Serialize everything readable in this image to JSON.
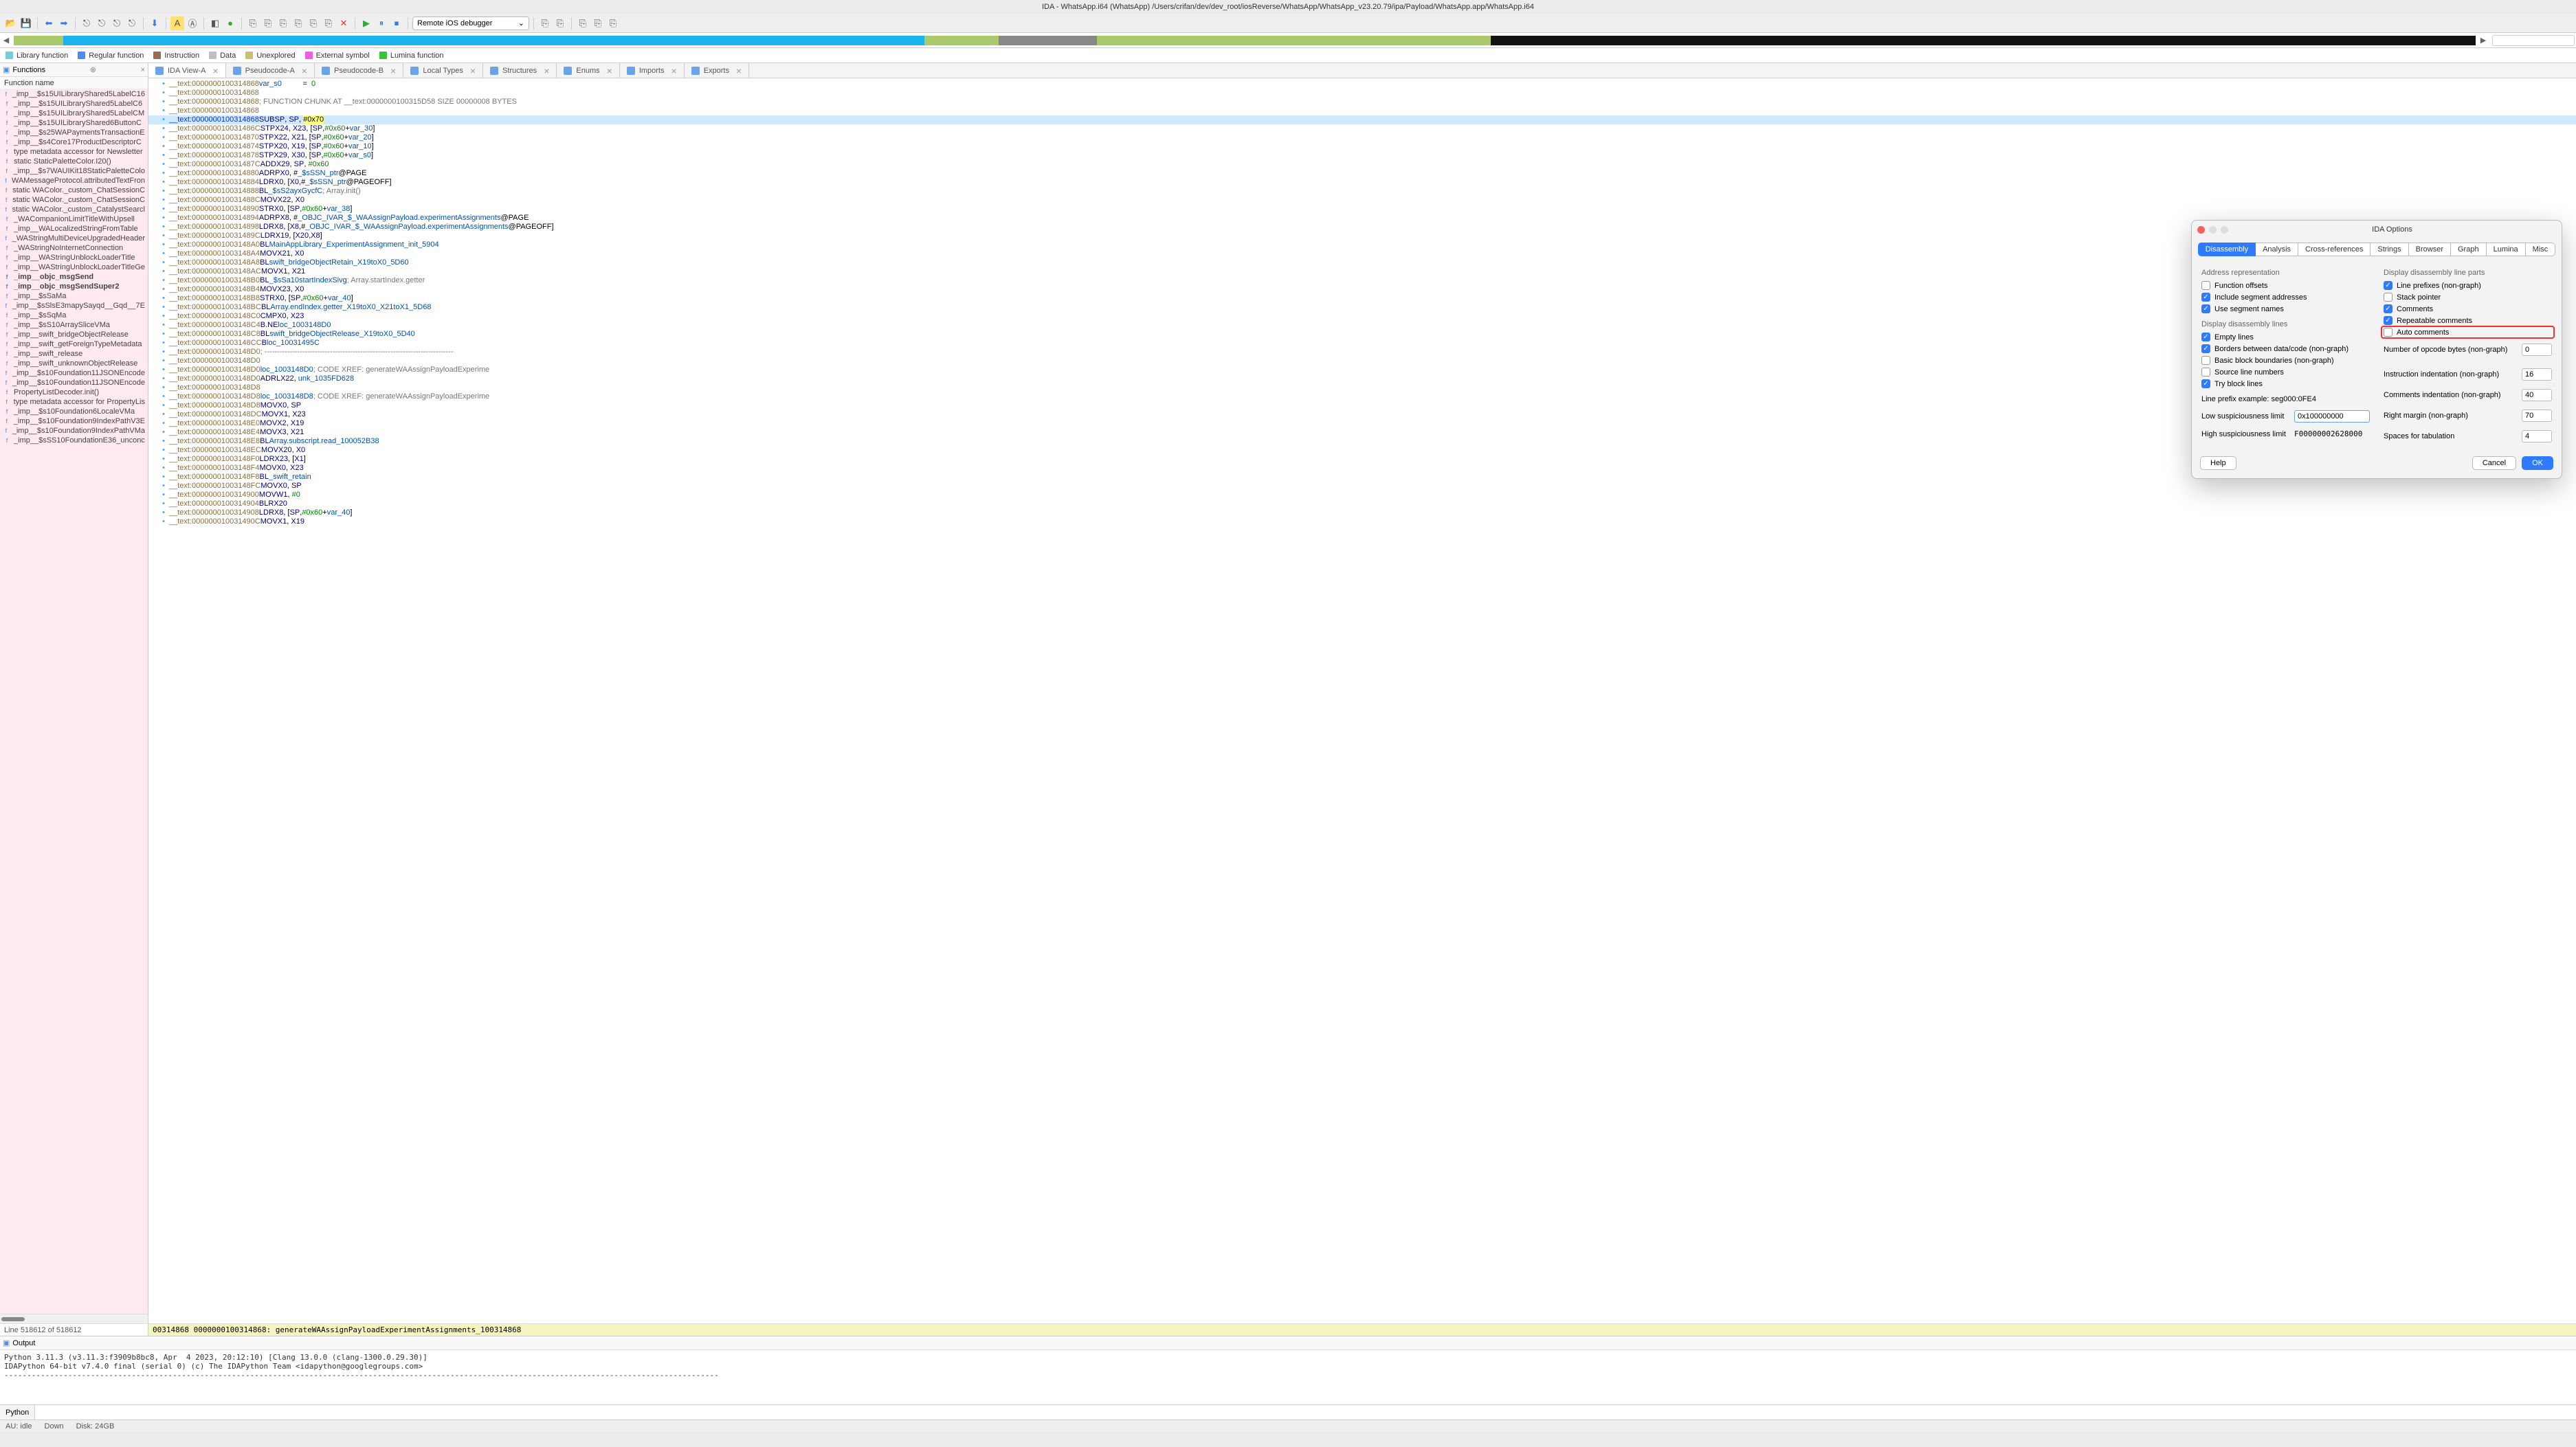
{
  "title": "IDA - WhatsApp.i64 (WhatsApp) /Users/crifan/dev/dev_root/iosReverse/WhatsApp/WhatsApp_v23.20.79/ipa/Payload/WhatsApp.app/WhatsApp.i64",
  "debugger": "Remote iOS debugger",
  "legend": {
    "lib": "Library function",
    "reg": "Regular function",
    "instr": "Instruction",
    "data": "Data",
    "unexpl": "Unexplored",
    "ext": "External symbol",
    "lum": "Lumina function"
  },
  "tabs": [
    {
      "label": "IDA View-A",
      "active": true
    },
    {
      "label": "Pseudocode-A"
    },
    {
      "label": "Pseudocode-B"
    },
    {
      "label": "Local Types"
    },
    {
      "label": "Structures"
    },
    {
      "label": "Enums"
    },
    {
      "label": "Imports"
    },
    {
      "label": "Exports"
    }
  ],
  "functions_header": "Functions",
  "functions_col": "Function name",
  "functions": [
    "_imp__$s15UILibraryShared5LabelC16",
    "_imp__$s15UILibraryShared5LabelC6",
    "_imp__$s15UILibraryShared5LabelCM",
    "_imp__$s15UILibraryShared6ButtonC",
    "_imp__$s25WAPaymentsTransactionE",
    "_imp__$s4Core17ProductDescriptorC",
    "type metadata accessor for Newsletter",
    "static StaticPaletteColor.I20()",
    "_imp__$s7WAUIKit18StaticPaletteColo",
    "WAMessageProtocol.attributedTextFron",
    "static WAColor._custom_ChatSessionC",
    "static WAColor._custom_ChatSessionC",
    "static WAColor._custom_CatalystSearcl",
    "_WACompanionLimitTitleWithUpsell",
    "_imp__WALocalizedStringFromTable",
    "_WAStringMultiDeviceUpgradedHeader",
    "_WAStringNoInternetConnection",
    "_imp__WAStringUnblockLoaderTitle",
    "_imp__WAStringUnblockLoaderTitleGe",
    "_imp__objc_msgSend",
    "_imp__objc_msgSendSuper2",
    "_imp__$sSaMa",
    "_imp__$sSlsE3mapySayqd__Gqd__7E",
    "_imp__$sSqMa",
    "_imp__$sS10ArraySliceVMa",
    "_imp__swift_bridgeObjectRelease",
    "_imp__swift_getForeignTypeMetadata",
    "_imp__swift_release",
    "_imp__swift_unknownObjectRelease",
    "_imp__$s10Foundation11JSONEncode",
    "_imp__$s10Foundation11JSONEncode",
    "PropertyListDecoder.init()",
    "type metadata accessor for PropertyLis",
    "_imp__$s10Foundation6LocaleVMa",
    "_imp__$s10Foundation9IndexPathV3E",
    "_imp__$s10Foundation9IndexPathVMa",
    "_imp__$sSS10FoundationE36_unconc"
  ],
  "functions_bold": [
    "_imp__objc_msgSend",
    "_imp__objc_msgSendSuper2"
  ],
  "functions_status": "Line 518612 of 518612",
  "lines": [
    {
      "a": "__text:0000000100314868",
      "t": "<span class='sym'>var_s0</span>          =  <span class='num'>0</span>"
    },
    {
      "a": "__text:0000000100314868",
      "t": ""
    },
    {
      "a": "__text:0000000100314868",
      "t": "<span class='cmt'>; FUNCTION CHUNK AT __text:0000000100315D58 SIZE 00000008 BYTES</span>"
    },
    {
      "a": "__text:0000000100314868",
      "t": ""
    },
    {
      "a": "__text:0000000100314868",
      "cur": true,
      "bold": true,
      "t": "<span class='mne'>SUB</span>             <span class='reg'>SP</span>, <span class='reg'>SP</span>, <span class='hl'>#0x70</span>"
    },
    {
      "a": "__text:000000010031486C",
      "t": "<span class='mne'>STP</span>             <span class='reg'>X24</span>, <span class='reg'>X23</span>, [<span class='reg'>SP</span>,<span class='num'>#0x60</span>+<span class='sym'>var_30</span>]"
    },
    {
      "a": "__text:0000000100314870",
      "t": "<span class='mne'>STP</span>             <span class='reg'>X22</span>, <span class='reg'>X21</span>, [<span class='reg'>SP</span>,<span class='num'>#0x60</span>+<span class='sym'>var_20</span>]"
    },
    {
      "a": "__text:0000000100314874",
      "t": "<span class='mne'>STP</span>             <span class='reg'>X20</span>, <span class='reg'>X19</span>, [<span class='reg'>SP</span>,<span class='num'>#0x60</span>+<span class='sym'>var_10</span>]"
    },
    {
      "a": "__text:0000000100314878",
      "t": "<span class='mne'>STP</span>             <span class='reg'>X29</span>, <span class='reg'>X30</span>, [<span class='reg'>SP</span>,<span class='num'>#0x60</span>+<span class='sym'>var_s0</span>]"
    },
    {
      "a": "__text:000000010031487C",
      "t": "<span class='mne'>ADD</span>             <span class='reg'>X29</span>, <span class='reg'>SP</span>, <span class='num'>#0x60</span>"
    },
    {
      "a": "__text:0000000100314880",
      "t": "<span class='mne'>ADRP</span>            <span class='reg'>X0</span>, #<span class='sym'>_$sSSN_ptr</span>@PAGE"
    },
    {
      "a": "__text:0000000100314884",
      "t": "<span class='mne'>LDR</span>             <span class='reg'>X0</span>, [<span class='reg'>X0</span>,#<span class='sym'>_$sSSN_ptr</span>@PAGEOFF]"
    },
    {
      "a": "__text:0000000100314888",
      "t": "<span class='mne'>BL</span>              <span class='sym'>_$sS2ayxGycfC</span> <span class='cmt'>; Array.init()</span>"
    },
    {
      "a": "__text:000000010031488C",
      "t": "<span class='mne'>MOV</span>             <span class='reg'>X22</span>, <span class='reg'>X0</span>"
    },
    {
      "a": "__text:0000000100314890",
      "t": "<span class='mne'>STR</span>             <span class='reg'>X0</span>, [<span class='reg'>SP</span>,<span class='num'>#0x60</span>+<span class='sym'>var_38</span>]"
    },
    {
      "a": "__text:0000000100314894",
      "t": "<span class='mne'>ADRP</span>            <span class='reg'>X8</span>, #<span class='sym'>_OBJC_IVAR_$_WAAssignPayload.experimentAssignments</span>@PAGE"
    },
    {
      "a": "__text:0000000100314898",
      "t": "<span class='mne'>LDR</span>             <span class='reg'>X8</span>, [<span class='reg'>X8</span>,#<span class='sym'>_OBJC_IVAR_$_WAAssignPayload.experimentAssignments</span>@PAGEOFF]"
    },
    {
      "a": "__text:000000010031489C",
      "t": "<span class='mne'>LDR</span>             <span class='reg'>X19</span>, [<span class='reg'>X20</span>,<span class='reg'>X8</span>]"
    },
    {
      "a": "__text:00000001003148A0",
      "t": "<span class='mne'>BL</span>              <span class='sym'>MainAppLibrary_ExperimentAssignment_init_5904</span>"
    },
    {
      "a": "__text:00000001003148A4",
      "t": "<span class='mne'>MOV</span>             <span class='reg'>X21</span>, <span class='reg'>X0</span>"
    },
    {
      "a": "__text:00000001003148A8",
      "t": "<span class='mne'>BL</span>              <span class='sym'>swift_bridgeObjectRetain_X19toX0_5D60</span>"
    },
    {
      "a": "__text:00000001003148AC",
      "t": "<span class='mne'>MOV</span>             <span class='reg'>X1</span>, <span class='reg'>X21</span>"
    },
    {
      "a": "__text:00000001003148B0",
      "t": "<span class='mne'>BL</span>              <span class='sym'>_$sSa10startIndexSivg</span> <span class='cmt'>; Array.startIndex.getter</span>"
    },
    {
      "a": "__text:00000001003148B4",
      "t": "<span class='mne'>MOV</span>             <span class='reg'>X23</span>, <span class='reg'>X0</span>"
    },
    {
      "a": "__text:00000001003148B8",
      "t": "<span class='mne'>STR</span>             <span class='reg'>X0</span>, [<span class='reg'>SP</span>,<span class='num'>#0x60</span>+<span class='sym'>var_40</span>]"
    },
    {
      "a": "__text:00000001003148BC",
      "t": "<span class='mne'>BL</span>              <span class='sym'>Array.endIndex.getter_X19toX0_X21toX1_5D68</span>"
    },
    {
      "a": "__text:00000001003148C0",
      "t": "<span class='mne'>CMP</span>             <span class='reg'>X0</span>, <span class='reg'>X23</span>"
    },
    {
      "a": "__text:00000001003148C4",
      "t": "<span class='mne'>B.NE</span>            <span class='sym'>loc_1003148D0</span>"
    },
    {
      "a": "__text:00000001003148C8",
      "t": "<span class='mne'>BL</span>              <span class='sym'>swift_bridgeObjectRelease_X19toX0_5D40</span>"
    },
    {
      "a": "__text:00000001003148CC",
      "t": "<span class='mne'>B</span>               <span class='sym'>loc_10031495C</span>"
    },
    {
      "a": "__text:00000001003148D0",
      "t": "<span class='cmt'>; ---------------------------------------------------------------------------</span>"
    },
    {
      "a": "__text:00000001003148D0",
      "t": ""
    },
    {
      "a": "__text:00000001003148D0",
      "t": "<span class='sym'>loc_1003148D0</span>                           <span class='cmt'>; CODE XREF: generateWAAssignPayloadExperime</span>"
    },
    {
      "a": "__text:00000001003148D0",
      "t": "<span class='mne'>ADRL</span>            <span class='reg'>X22</span>, <span class='sym'>unk_1035FD628</span>"
    },
    {
      "a": "__text:00000001003148D8",
      "t": ""
    },
    {
      "a": "__text:00000001003148D8",
      "t": "<span class='sym'>loc_1003148D8</span>                           <span class='cmt'>; CODE XREF: generateWAAssignPayloadExperime</span>"
    },
    {
      "a": "__text:00000001003148D8",
      "t": "<span class='mne'>MOV</span>             <span class='reg'>X0</span>, <span class='reg'>SP</span>"
    },
    {
      "a": "__text:00000001003148DC",
      "t": "<span class='mne'>MOV</span>             <span class='reg'>X1</span>, <span class='reg'>X23</span>"
    },
    {
      "a": "__text:00000001003148E0",
      "t": "<span class='mne'>MOV</span>             <span class='reg'>X2</span>, <span class='reg'>X19</span>"
    },
    {
      "a": "__text:00000001003148E4",
      "t": "<span class='mne'>MOV</span>             <span class='reg'>X3</span>, <span class='reg'>X21</span>"
    },
    {
      "a": "__text:00000001003148E8",
      "t": "<span class='mne'>BL</span>              <span class='sym'>Array.subscript.read_100052B38</span>"
    },
    {
      "a": "__text:00000001003148EC",
      "t": "<span class='mne'>MOV</span>             <span class='reg'>X20</span>, <span class='reg'>X0</span>"
    },
    {
      "a": "__text:00000001003148F0",
      "t": "<span class='mne'>LDR</span>             <span class='reg'>X23</span>, [<span class='reg'>X1</span>]"
    },
    {
      "a": "__text:00000001003148F4",
      "t": "<span class='mne'>MOV</span>             <span class='reg'>X0</span>, <span class='reg'>X23</span>"
    },
    {
      "a": "__text:00000001003148F8",
      "t": "<span class='mne'>BL</span>              <span class='sym'>_swift_retain</span>"
    },
    {
      "a": "__text:00000001003148FC",
      "t": "<span class='mne'>MOV</span>             <span class='reg'>X0</span>, <span class='reg'>SP</span>"
    },
    {
      "a": "__text:0000000100314900",
      "t": "<span class='mne'>MOV</span>             <span class='reg'>W1</span>, <span class='num'>#0</span>"
    },
    {
      "a": "__text:0000000100314904",
      "t": "<span class='mne'>BLR</span>             <span class='reg'>X20</span>"
    },
    {
      "a": "__text:0000000100314908",
      "t": "<span class='mne'>LDR</span>             <span class='reg'>X8</span>, [<span class='reg'>SP</span>,<span class='num'>#0x60</span>+<span class='sym'>var_40</span>]"
    },
    {
      "a": "__text:000000010031490C",
      "t": "<span class='mne'>MOV</span>             <span class='reg'>X1</span>, <span class='reg'>X19</span>"
    }
  ],
  "status_addr": "00314868 0000000100314868: generateWAAssignPayloadExperimentAssignments_100314868",
  "output_header": "Output",
  "output_lines": "Python 3.11.3 (v3.11.3:f3909b8bc8, Apr  4 2023, 20:12:10) [Clang 13.0.0 (clang-1300.0.29.30)]\nIDAPython 64-bit v7.4.0 final (serial 0) (c) The IDAPython Team <idapython@googlegroups.com>\n-------------------------------------------------------------------------------------------------------------------------------------------------------------",
  "console_prompt": "Python",
  "statusbar": {
    "au": "AU:",
    "idle": "idle",
    "down": "Down",
    "disk": "Disk: 24GB"
  },
  "dialog": {
    "title": "IDA Options",
    "tabs": [
      "Disassembly",
      "Analysis",
      "Cross-references",
      "Strings",
      "Browser",
      "Graph",
      "Lumina",
      "Misc"
    ],
    "active_tab": "Disassembly",
    "left": {
      "grp1": "Address representation",
      "function_offsets": "Function offsets",
      "include_seg": "Include segment addresses",
      "use_seg": "Use segment names",
      "grp2": "Display disassembly lines",
      "empty": "Empty lines",
      "borders": "Borders between data/code (non-graph)",
      "basic": "Basic block boundaries (non-graph)",
      "source": "Source line numbers",
      "try": "Try block lines",
      "prefix_ex_label": "Line prefix example:",
      "prefix_ex_val": "seg000:0FE4",
      "low_label": "Low suspiciousness limit",
      "low_val": "0x100000000",
      "high_label": "High suspiciousness limit",
      "high_val": "F00000002628000"
    },
    "right": {
      "grp": "Display disassembly line parts",
      "line_prefix": "Line prefixes (non-graph)",
      "stack_ptr": "Stack pointer",
      "comments": "Comments",
      "repeat": "Repeatable comments",
      "auto": "Auto comments",
      "opcode_label": "Number of opcode bytes (non-graph)",
      "opcode_val": "0",
      "instr_ind_label": "Instruction indentation (non-graph)",
      "instr_ind_val": "16",
      "cmt_ind_label": "Comments indentation (non-graph)",
      "cmt_ind_val": "40",
      "rmargin_label": "Right margin (non-graph)",
      "rmargin_val": "70",
      "tab_label": "Spaces for tabulation",
      "tab_val": "4"
    },
    "help": "Help",
    "cancel": "Cancel",
    "ok": "OK"
  }
}
